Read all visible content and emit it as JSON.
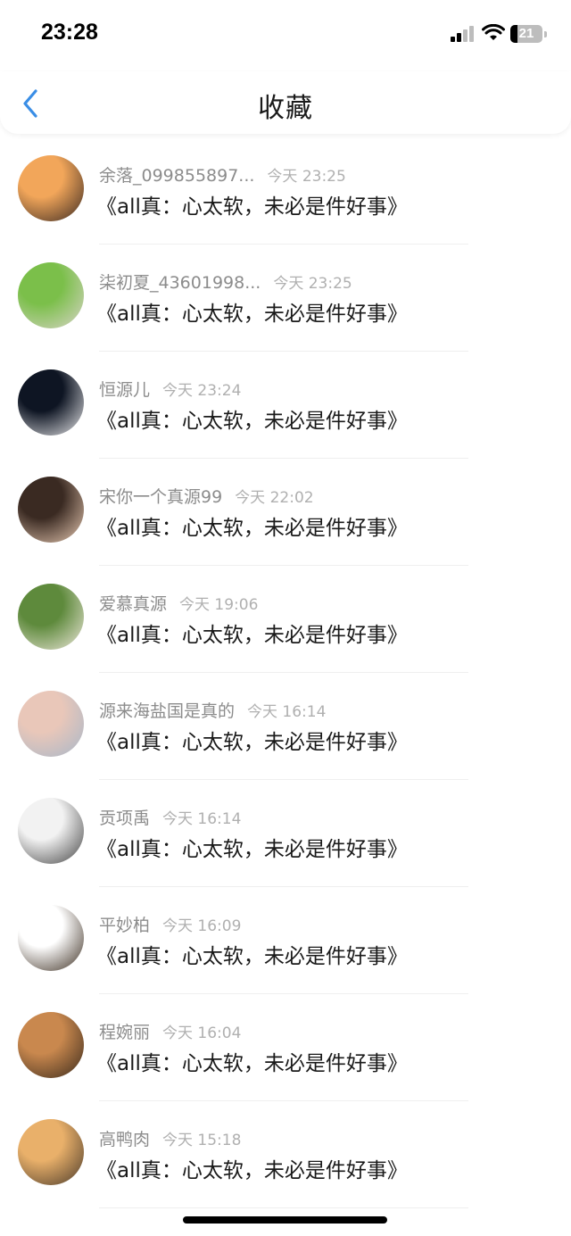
{
  "status_bar": {
    "time": "23:28",
    "battery": "21"
  },
  "header": {
    "title": "收藏"
  },
  "favorites": [
    {
      "user": "余落_099855897...",
      "time": "今天 23:25",
      "title": "《all真：心太软，未必是件好事》",
      "avatar_colors": [
        "#f2a65a",
        "#3b2a22"
      ]
    },
    {
      "user": "柒初夏_43601998...",
      "time": "今天 23:25",
      "title": "《all真：心太软，未必是件好事》",
      "avatar_colors": [
        "#7bbf4a",
        "#d9d4c9"
      ]
    },
    {
      "user": "恒源儿",
      "time": "今天 23:24",
      "title": "《all真：心太软，未必是件好事》",
      "avatar_colors": [
        "#0e1523",
        "#e8e8ea"
      ]
    },
    {
      "user": "宋你一个真源99",
      "time": "今天 22:02",
      "title": "《all真：心太软，未必是件好事》",
      "avatar_colors": [
        "#3a2a22",
        "#e7c9b2"
      ]
    },
    {
      "user": "爱慕真源",
      "time": "今天 19:06",
      "title": "《all真：心太软，未必是件好事》",
      "avatar_colors": [
        "#5e8a3c",
        "#efe8dc"
      ]
    },
    {
      "user": "源来海盐国是真的",
      "time": "今天 16:14",
      "title": "《all真：心太软，未必是件好事》",
      "avatar_colors": [
        "#e9c7b9",
        "#a7b7c9"
      ]
    },
    {
      "user": "贡项禹",
      "time": "今天 16:14",
      "title": "《all真：心太软，未必是件好事》",
      "avatar_colors": [
        "#f2f2f2",
        "#444444"
      ]
    },
    {
      "user": "平妙柏",
      "time": "今天 16:09",
      "title": "《all真：心太软，未必是件好事》",
      "avatar_colors": [
        "#ffffff",
        "#3d2f22"
      ]
    },
    {
      "user": "程婉丽",
      "time": "今天 16:04",
      "title": "《all真：心太软，未必是件好事》",
      "avatar_colors": [
        "#c9884e",
        "#3a2a1c"
      ]
    },
    {
      "user": "高鸭肉",
      "time": "今天 15:18",
      "title": "《all真：心太软，未必是件好事》",
      "avatar_colors": [
        "#e9b06a",
        "#4a3a2a"
      ]
    }
  ]
}
